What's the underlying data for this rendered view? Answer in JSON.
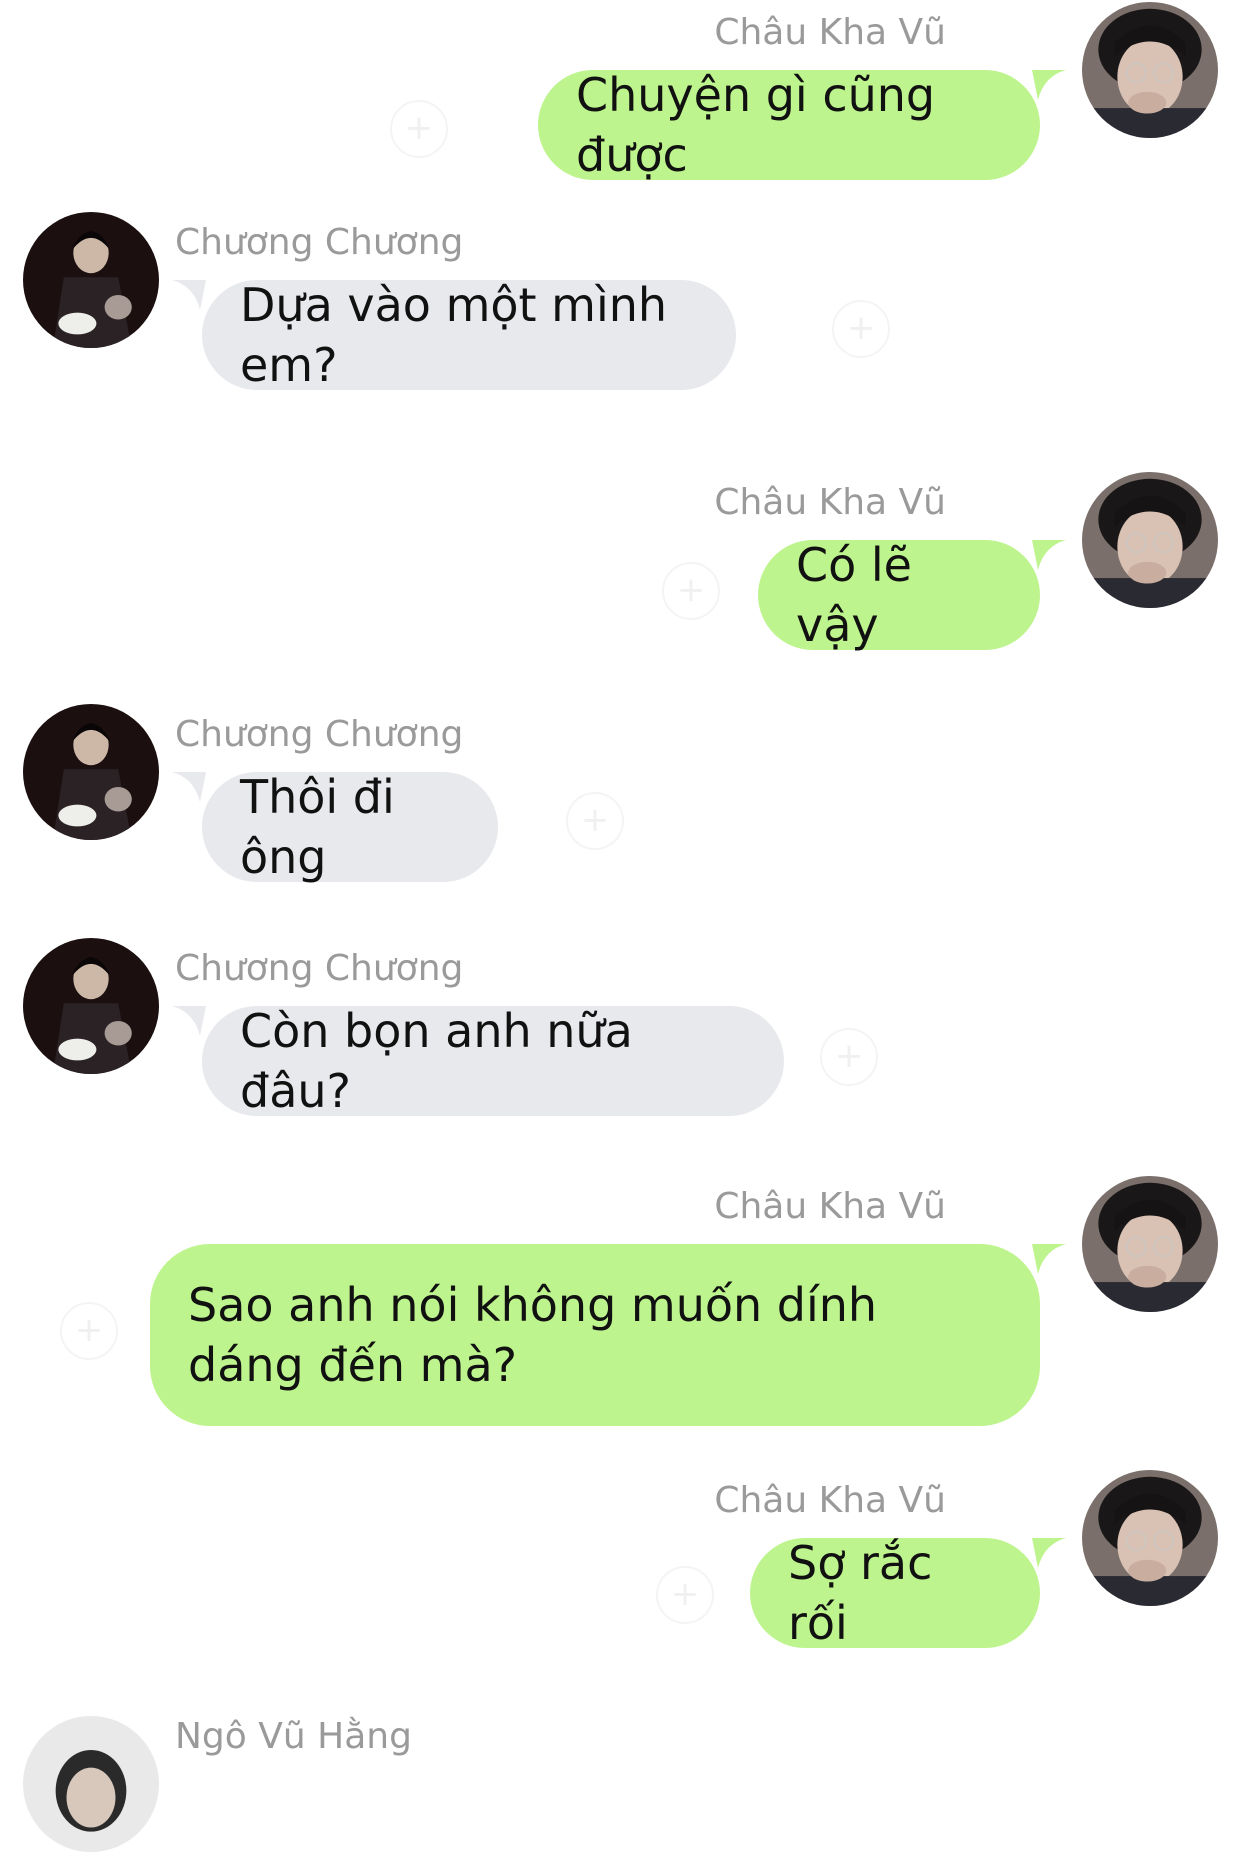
{
  "colors": {
    "outgoing_bubble": "#bef48d",
    "incoming_bubble": "#e7e9ec",
    "sender_name": "#9a9a9a",
    "text": "#111111"
  },
  "icons": {
    "reaction": "add-reaction-icon",
    "reaction_glyph": "+"
  },
  "messages": [
    {
      "direction": "outgoing",
      "sender": "Châu Kha Vũ",
      "text": "Chuyện gì cũng được"
    },
    {
      "direction": "incoming",
      "sender": "Chương Chương",
      "text": "Dựa vào một mình em?"
    },
    {
      "direction": "outgoing",
      "sender": "Châu Kha Vũ",
      "text": "Có lẽ vậy"
    },
    {
      "direction": "incoming",
      "sender": "Chương Chương",
      "text": "Thôi đi ông"
    },
    {
      "direction": "incoming",
      "sender": "Chương Chương",
      "text": "Còn bọn anh nữa đâu?"
    },
    {
      "direction": "outgoing",
      "sender": "Châu Kha Vũ",
      "text": "Sao anh nói không muốn dính dáng đến mà?"
    },
    {
      "direction": "outgoing",
      "sender": "Châu Kha Vũ",
      "text": "Sợ rắc rối"
    },
    {
      "direction": "incoming",
      "sender": "Ngô Vũ Hằng",
      "text": ""
    }
  ]
}
